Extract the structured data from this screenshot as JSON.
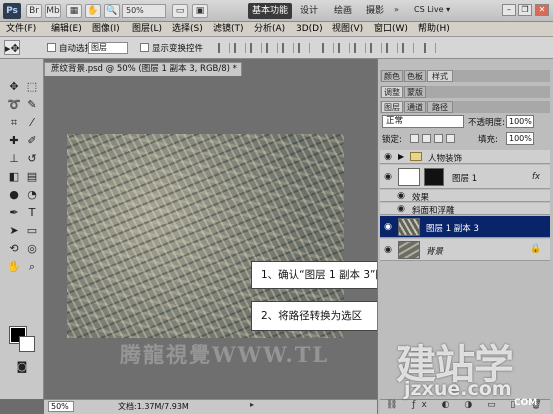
{
  "app": {
    "logo": "Ps",
    "zoom": "50%",
    "workspace_active": "基本功能",
    "workspaces": [
      "设计",
      "绘画",
      "摄影"
    ],
    "workspace_more": "»",
    "cslive": "CS Live ▾"
  },
  "menus": [
    "文件(F)",
    "编辑(E)",
    "图像(I)",
    "图层(L)",
    "选择(S)",
    "滤镜(T)",
    "分析(A)",
    "3D(D)",
    "视图(V)",
    "窗口(W)",
    "帮助(H)"
  ],
  "options": {
    "auto_select_label": "自动选择:",
    "auto_select_value": "图层",
    "show_transform_label": "显示变换控件"
  },
  "document": {
    "tab_title": "蔗纹背景.psd @ 50% (图层 1 副本 3, RGB/8) *",
    "status_zoom": "50%",
    "status_doc": "文档:1.37M/7.93M"
  },
  "callouts": {
    "step1": "1、确认“图层 1 副本 3”图层为当前可编辑状态",
    "step2": "2、将路径转换为选区"
  },
  "watermarks": {
    "left": "腾龍視覺WWW.TL",
    "right_big": "建站学",
    "right_url": "jzxue.com",
    "right_suffix": "COM"
  },
  "panels": {
    "top_tabs": [
      "颜色",
      "色板",
      "样式"
    ],
    "mid_tabs": [
      "调整",
      "蒙版"
    ],
    "layer_tabs": [
      "图层",
      "通道",
      "路径"
    ],
    "blend_mode": "正常",
    "opacity_label": "不透明度:",
    "opacity_value": "100%",
    "lock_label": "锁定:",
    "fill_label": "填充:",
    "fill_value": "100%"
  },
  "layers": [
    {
      "name": "人物装饰",
      "kind": "group"
    },
    {
      "name": "图层 1",
      "kind": "layer",
      "fx": "fx"
    },
    {
      "name": "效果",
      "kind": "effect"
    },
    {
      "name": "斜面和浮雕",
      "kind": "effect"
    },
    {
      "name": "图层 1 副本 3",
      "kind": "layer",
      "selected": true
    },
    {
      "name": "背景",
      "kind": "background"
    }
  ],
  "colors": {
    "selection": "#0a246a",
    "foreground": "#000000",
    "background": "#ffffff"
  }
}
